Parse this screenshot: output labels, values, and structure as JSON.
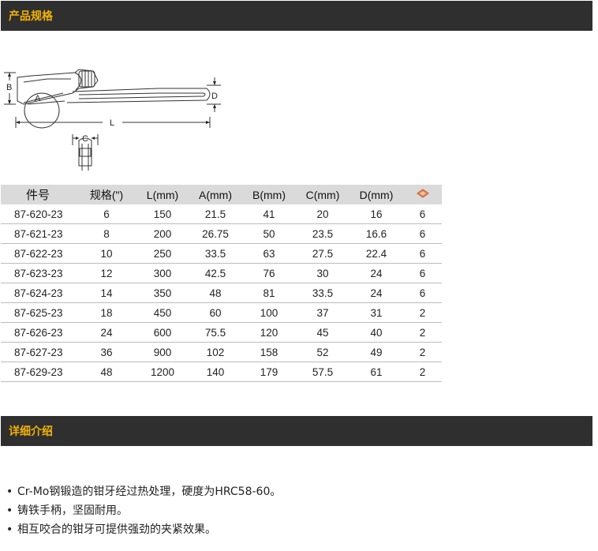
{
  "sections": {
    "spec_title": "产品规格",
    "detail_title": "详细介绍"
  },
  "diagram": {
    "labels": {
      "b": "B",
      "a": "A",
      "d": "D",
      "l": "L",
      "c": "C"
    }
  },
  "table": {
    "headers": [
      "件号",
      "规格(\")",
      "L(mm)",
      "A(mm)",
      "B(mm)",
      "C(mm)",
      "D(mm)"
    ],
    "package_icon": "package-icon",
    "rows": [
      [
        "87-620-23",
        "6",
        "150",
        "21.5",
        "41",
        "20",
        "16",
        "6"
      ],
      [
        "87-621-23",
        "8",
        "200",
        "26.75",
        "50",
        "23.5",
        "16.6",
        "6"
      ],
      [
        "87-622-23",
        "10",
        "250",
        "33.5",
        "63",
        "27.5",
        "22.4",
        "6"
      ],
      [
        "87-623-23",
        "12",
        "300",
        "42.5",
        "76",
        "30",
        "24",
        "6"
      ],
      [
        "87-624-23",
        "14",
        "350",
        "48",
        "81",
        "33.5",
        "24",
        "6"
      ],
      [
        "87-625-23",
        "18",
        "450",
        "60",
        "100",
        "37",
        "31",
        "2"
      ],
      [
        "87-626-23",
        "24",
        "600",
        "75.5",
        "120",
        "45",
        "40",
        "2"
      ],
      [
        "87-627-23",
        "36",
        "900",
        "102",
        "158",
        "52",
        "49",
        "2"
      ],
      [
        "87-629-23",
        "48",
        "1200",
        "140",
        "179",
        "57.5",
        "61",
        "2"
      ]
    ]
  },
  "features": [
    "Cr-Mo钢锻造的钳牙经过热处理，硬度为HRC58-60。",
    "铸铁手柄，坚固耐用。",
    "相互咬合的钳牙可提供强劲的夹紧效果。"
  ],
  "colors": {
    "bar": "#2f2f2f",
    "bar_title": "#f2b200",
    "header_row": "#dadada"
  }
}
